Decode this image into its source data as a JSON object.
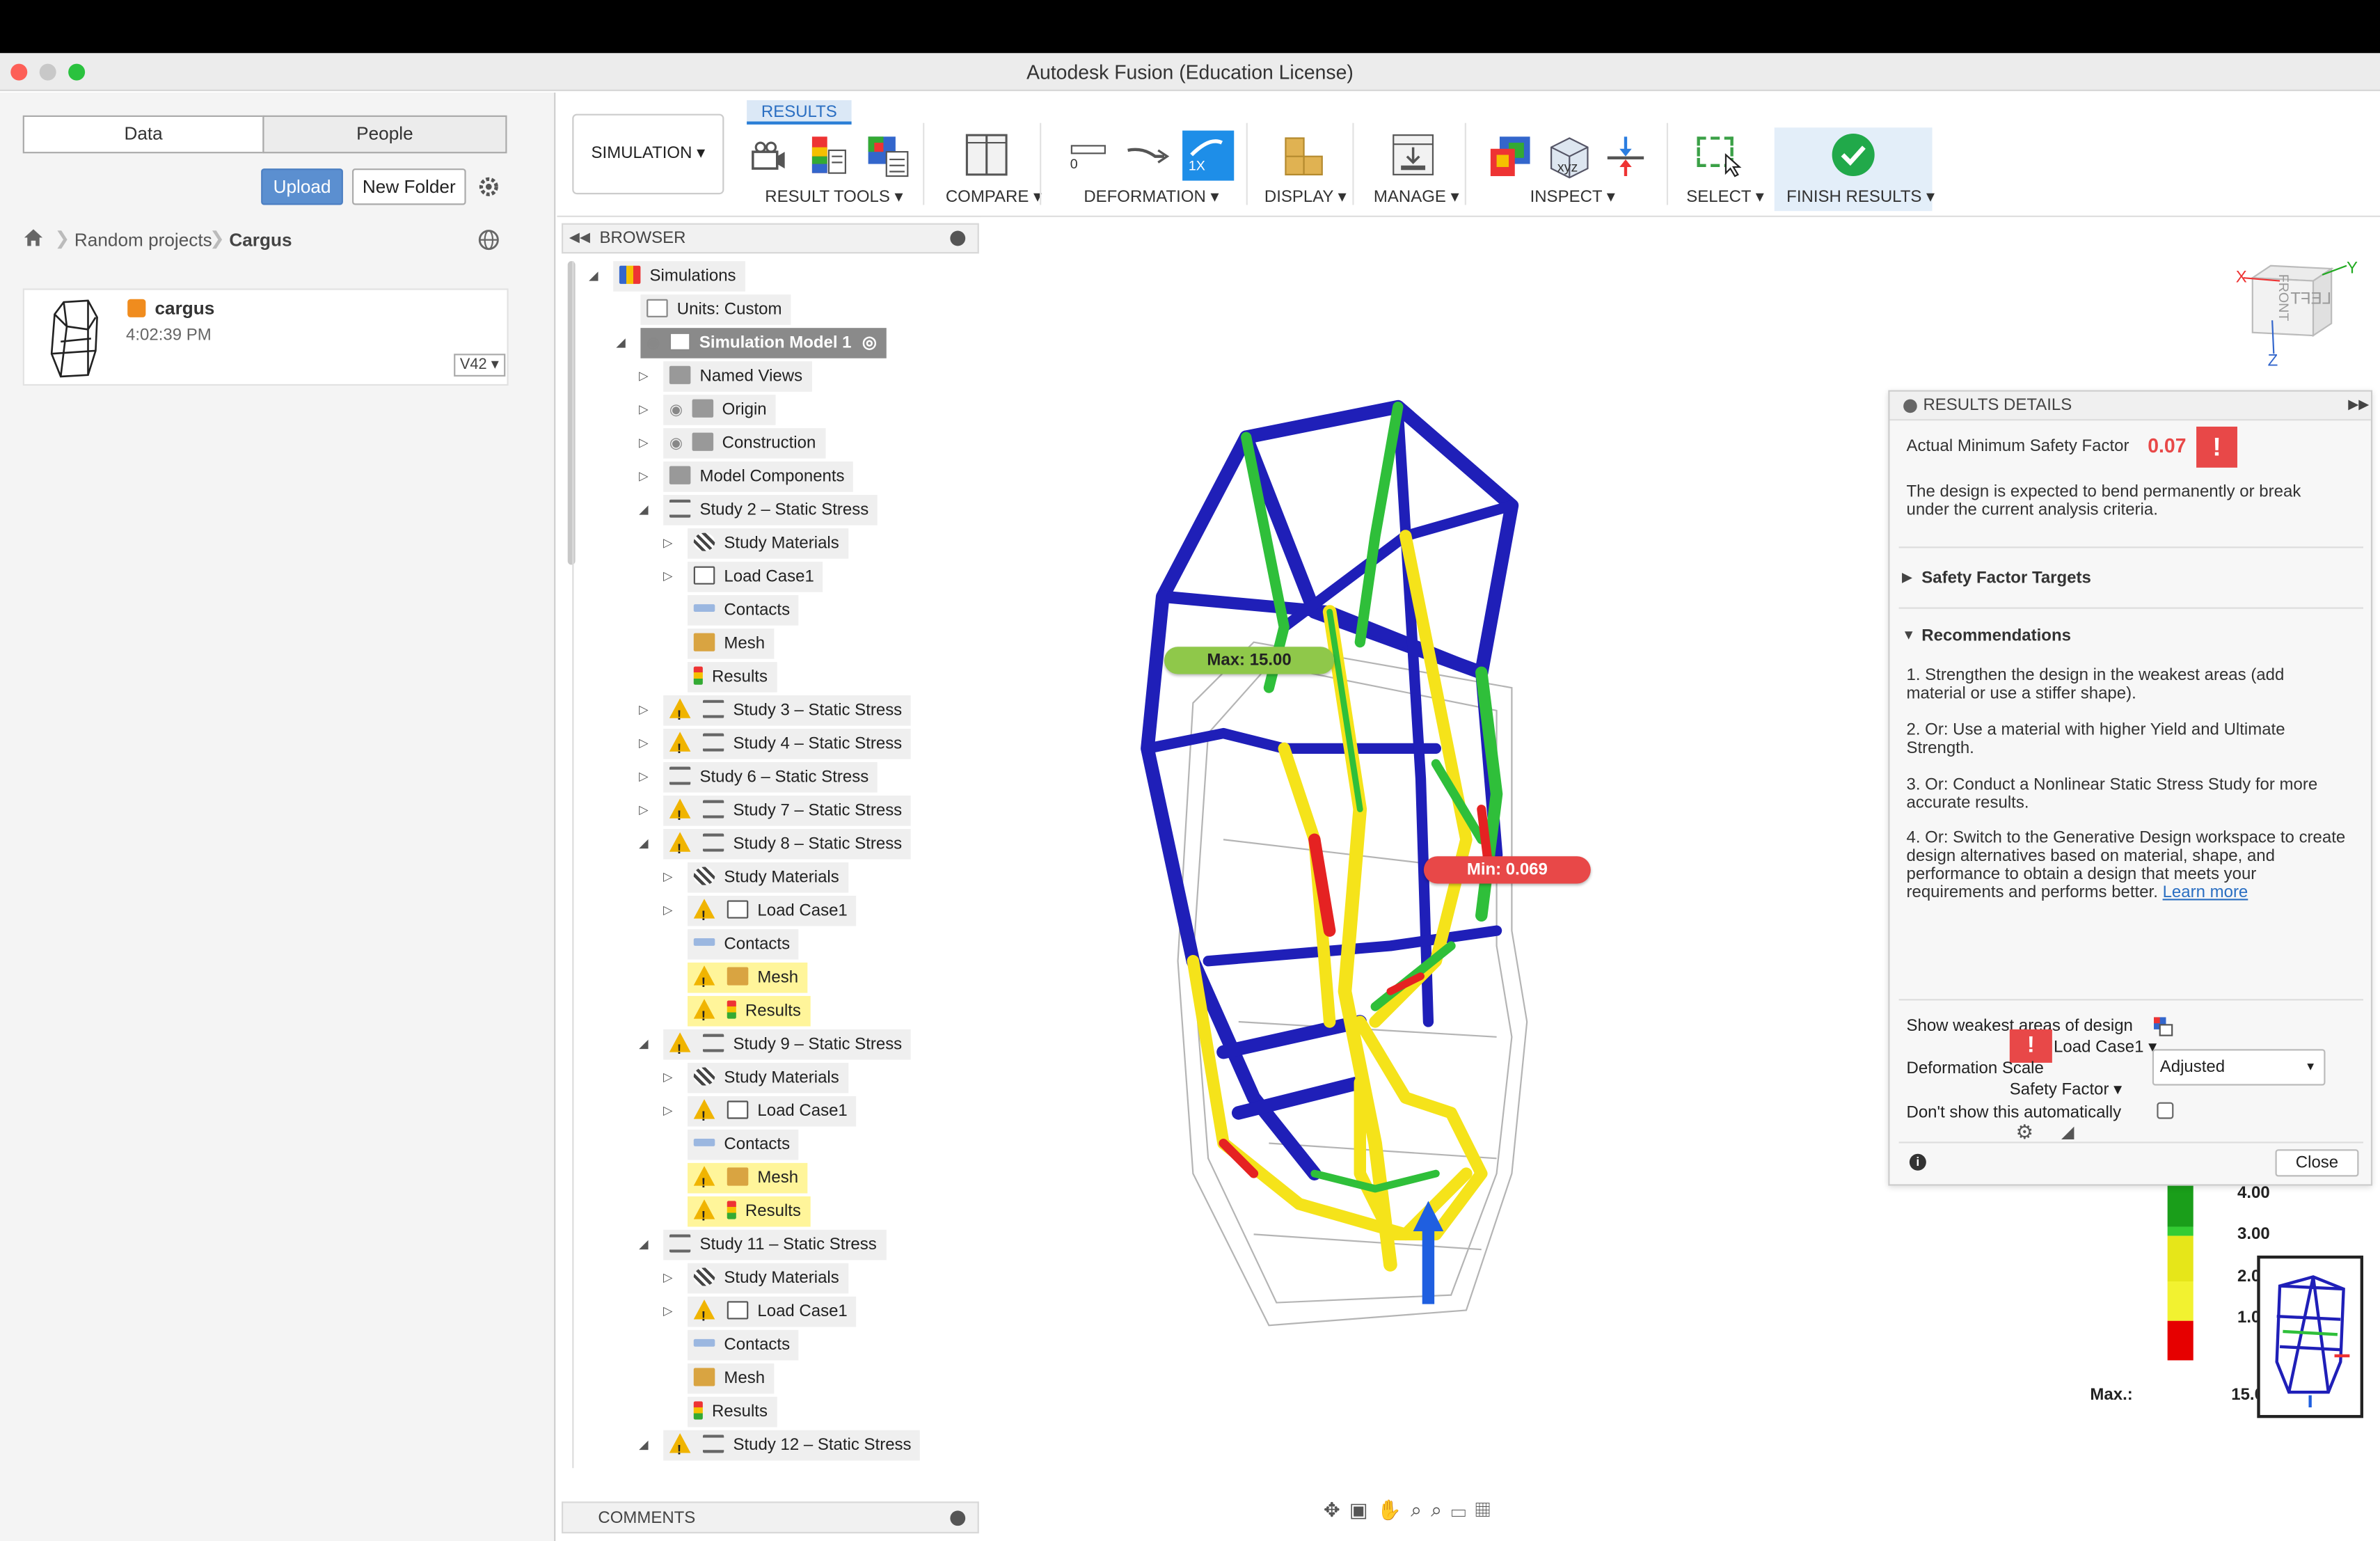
{
  "window": {
    "title": "Autodesk Fusion (Education License)"
  },
  "data_panel": {
    "tabs": [
      "Data",
      "People"
    ],
    "upload_label": "Upload",
    "new_folder_label": "New Folder",
    "breadcrumb": [
      "Random projects",
      "Cargus"
    ],
    "file": {
      "name": "cargus",
      "time": "4:02:39 PM",
      "version": "V42"
    }
  },
  "toolbar": {
    "workspace": "SIMULATION",
    "tab": "RESULTS",
    "groups": [
      "RESULT TOOLS",
      "COMPARE",
      "DEFORMATION",
      "DISPLAY",
      "MANAGE",
      "INSPECT",
      "SELECT",
      "FINISH RESULTS"
    ],
    "deform_zero": "0",
    "deform_one": "1X",
    "inspect_xyz": "xyz"
  },
  "browser": {
    "title": "BROWSER",
    "rows": [
      {
        "label": "Simulations"
      },
      {
        "label": "Units: Custom"
      },
      {
        "label": "Simulation Model 1"
      },
      {
        "label": "Named Views"
      },
      {
        "label": "Origin"
      },
      {
        "label": "Construction"
      },
      {
        "label": "Model Components"
      },
      {
        "label": "Study 2 – Static Stress"
      },
      {
        "label": "Study Materials"
      },
      {
        "label": "Load Case1"
      },
      {
        "label": "Contacts"
      },
      {
        "label": "Mesh"
      },
      {
        "label": "Results"
      },
      {
        "label": "Study 3 – Static Stress"
      },
      {
        "label": "Study 4 – Static Stress"
      },
      {
        "label": "Study 6 – Static Stress"
      },
      {
        "label": "Study 7 – Static Stress"
      },
      {
        "label": "Study 8 – Static Stress"
      },
      {
        "label": "Study Materials"
      },
      {
        "label": "Load Case1"
      },
      {
        "label": "Contacts"
      },
      {
        "label": "Mesh"
      },
      {
        "label": "Results"
      },
      {
        "label": "Study 9 – Static Stress"
      },
      {
        "label": "Study Materials"
      },
      {
        "label": "Load Case1"
      },
      {
        "label": "Contacts"
      },
      {
        "label": "Mesh"
      },
      {
        "label": "Results"
      },
      {
        "label": "Study 11 – Static Stress"
      },
      {
        "label": "Study Materials"
      },
      {
        "label": "Load Case1"
      },
      {
        "label": "Contacts"
      },
      {
        "label": "Mesh"
      },
      {
        "label": "Results"
      },
      {
        "label": "Study 12 – Static Stress"
      }
    ],
    "comments": "COMMENTS"
  },
  "viewport": {
    "max_label": "Max: 15.00",
    "min_label": "Min: 0.069",
    "viewcube": {
      "left": "LEFT",
      "front": "FRONT",
      "x": "X",
      "y": "Y",
      "z": "Z"
    },
    "legend_ticks": [
      "4.00",
      "3.00",
      "2.0",
      "1.0"
    ],
    "legend_max_label": "Max.:",
    "legend_max_value": "15.0",
    "legend_colors": [
      "#1a9e1a",
      "#33cc33",
      "#e6e619",
      "#f2f230",
      "#e60000"
    ]
  },
  "results_details": {
    "title": "RESULTS DETAILS",
    "min_sf_label": "Actual Minimum Safety Factor",
    "min_sf_value": "0.07",
    "message": "The design is expected to bend permanently or break under the current analysis criteria.",
    "sf_targets": "Safety Factor Targets",
    "recommendations": "Recommendations",
    "rec1": "1. Strengthen the design in the weakest areas (add material or use a stiffer shape).",
    "rec2": "2. Or: Use a material with higher Yield and Ultimate Strength.",
    "rec3": "3. Or: Conduct a Nonlinear Static Stress Study for more accurate results.",
    "rec4": "4. Or: Switch to the Generative Design workspace to create design alternatives based on material, shape, and performance to obtain a design that meets your requirements and performs better.",
    "learn_more": "Learn more",
    "show_weakest": "Show weakest areas of design",
    "load_case": "Load Case1",
    "deformation_scale": "Deformation Scale",
    "deformation_value": "Adjusted",
    "safety_factor": "Safety Factor",
    "dont_show": "Don't show this automatically",
    "close": "Close"
  },
  "accent": "#2b7fd6",
  "danger": "#e84848"
}
